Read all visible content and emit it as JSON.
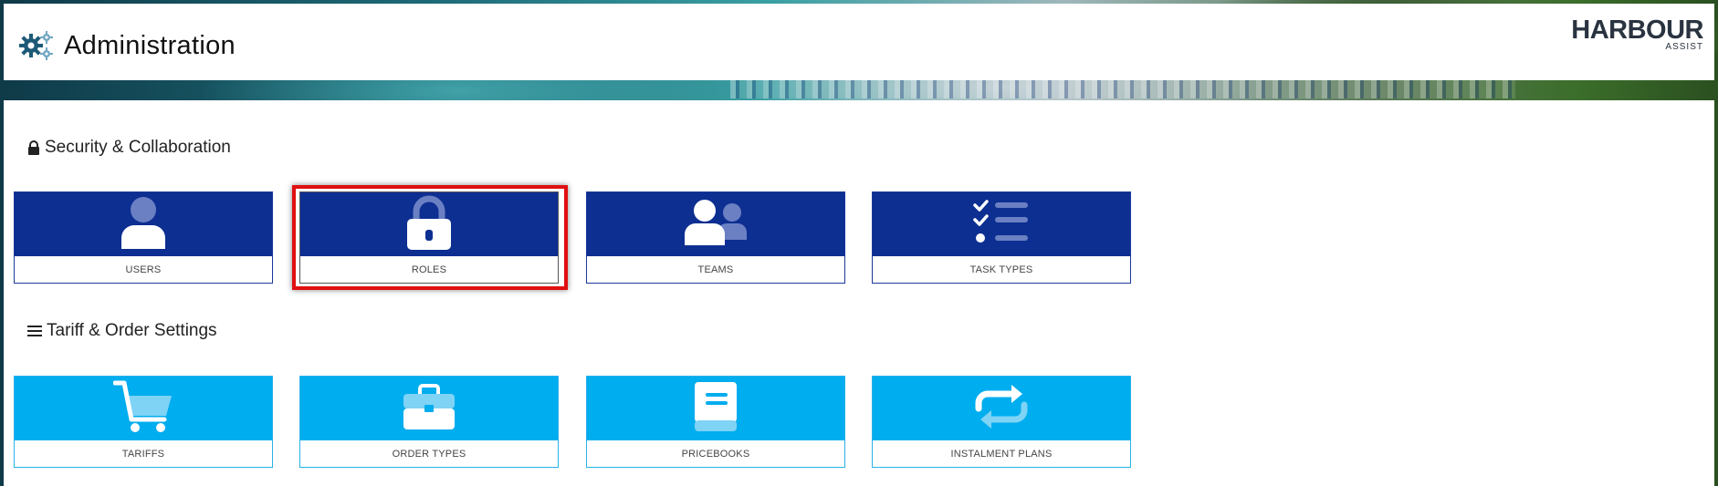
{
  "header": {
    "title": "Administration",
    "icon": "gears-icon",
    "logo": {
      "main": "HARBOUR",
      "sub": "ASSIST"
    }
  },
  "sections": [
    {
      "title": "Security & Collaboration",
      "icon": "lock-icon",
      "tiles": [
        {
          "label": "USERS",
          "icon": "user-icon"
        },
        {
          "label": "ROLES",
          "icon": "lock-icon",
          "highlighted": true
        },
        {
          "label": "TEAMS",
          "icon": "users-icon"
        },
        {
          "label": "TASK TYPES",
          "icon": "checklist-icon"
        }
      ]
    },
    {
      "title": "Tariff & Order Settings",
      "icon": "list-icon",
      "tiles": [
        {
          "label": "TARIFFS",
          "icon": "cart-icon"
        },
        {
          "label": "ORDER TYPES",
          "icon": "briefcase-icon"
        },
        {
          "label": "PRICEBOOKS",
          "icon": "book-icon"
        },
        {
          "label": "INSTALMENT PLANS",
          "icon": "repeat-icon"
        }
      ]
    }
  ],
  "colors": {
    "dark_tile": "#0d2f91",
    "light_tile": "#00adee",
    "highlight": "#e01010",
    "gear": "#1e5a78"
  }
}
